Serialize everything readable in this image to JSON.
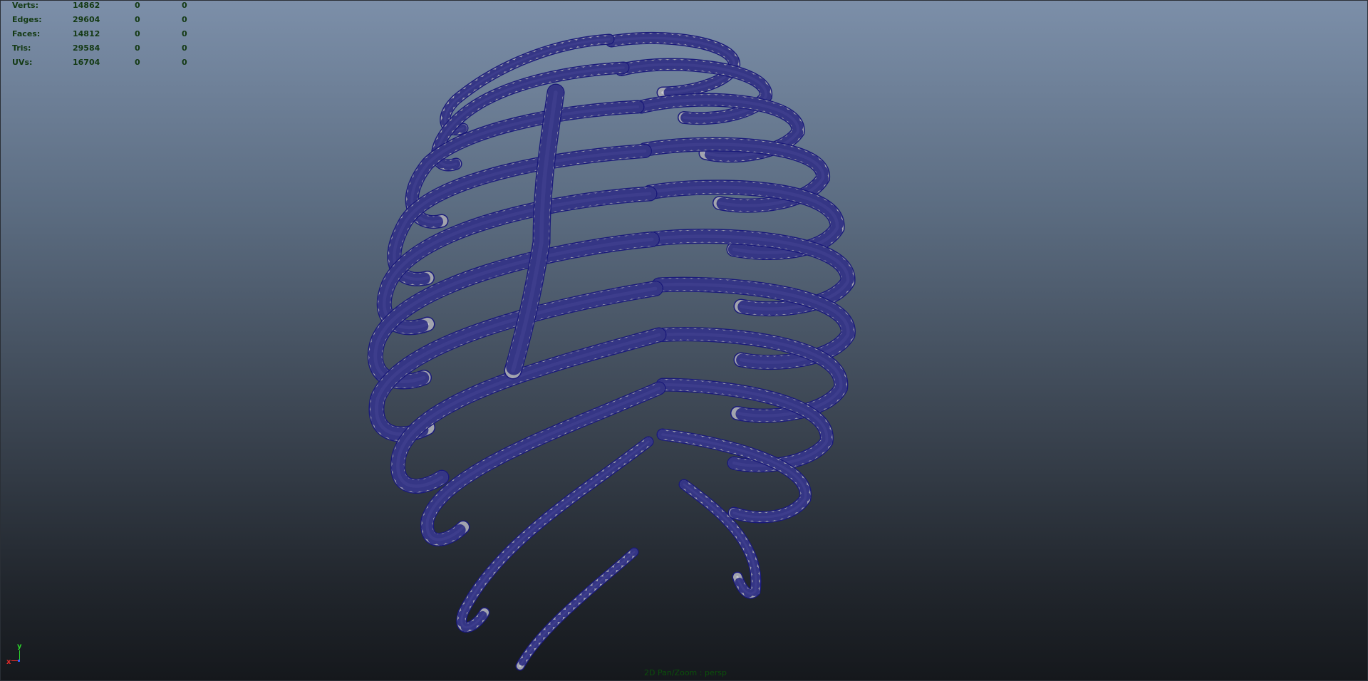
{
  "hud": {
    "rows": [
      {
        "label": "Verts:",
        "v1": "14862",
        "v2": "0",
        "v3": "0"
      },
      {
        "label": "Edges:",
        "v1": "29604",
        "v2": "0",
        "v3": "0"
      },
      {
        "label": "Faces:",
        "v1": "14812",
        "v2": "0",
        "v3": "0"
      },
      {
        "label": "Tris:",
        "v1": "29584",
        "v2": "0",
        "v3": "0"
      },
      {
        "label": "UVs:",
        "v1": "16704",
        "v2": "0",
        "v3": "0"
      }
    ]
  },
  "axis": {
    "y_label": "y",
    "x_label": "x"
  },
  "camera": {
    "label": "2D Pan/Zoom : persp"
  },
  "colors": {
    "hud_text": "#143a14",
    "wire": "#1a1a7a",
    "bone": "#a2a4ae",
    "camera_label": "#0b4f0b"
  },
  "icons": [
    "axis-gizmo-icon"
  ]
}
